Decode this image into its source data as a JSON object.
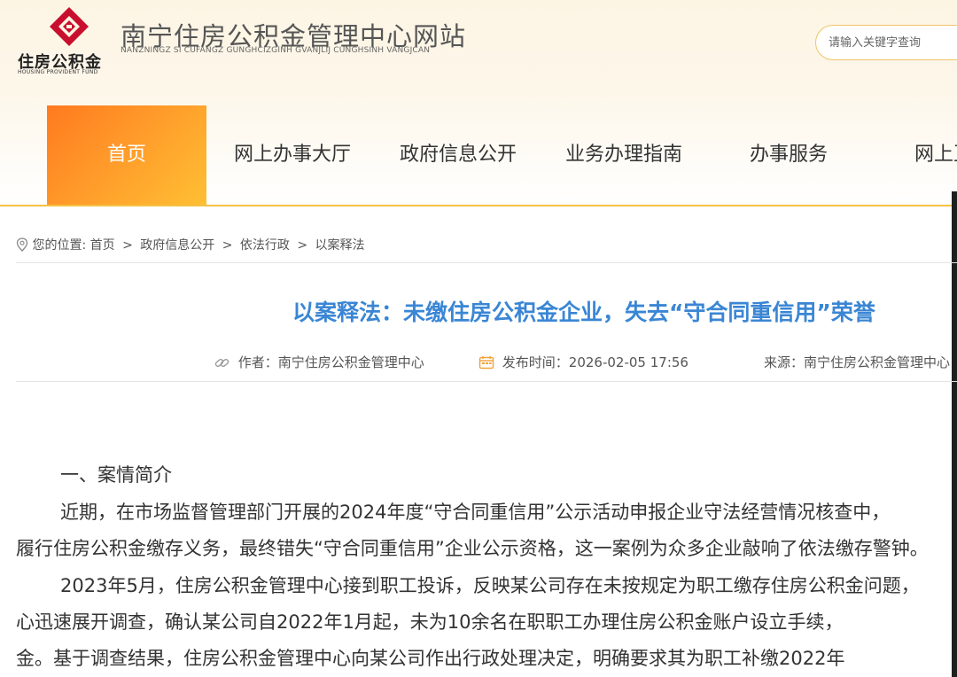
{
  "header": {
    "logo_text": "住房公积金",
    "logo_en": "HOUSING PROVIDENT FUND",
    "site_title": "南宁住房公积金管理中心网站",
    "site_subtitle": "NANZNINGZ SI CUFANGZ GUNGHCIZGINH GVANJLIJ CUNGHSINH VANGJCAN",
    "search_placeholder": "请输入关键字查询"
  },
  "nav": {
    "items": [
      {
        "label": "首页",
        "active": true
      },
      {
        "label": "网上办事大厅"
      },
      {
        "label": "政府信息公开"
      },
      {
        "label": "业务办理指南"
      },
      {
        "label": "办事服务"
      },
      {
        "label": "网上互动"
      }
    ]
  },
  "breadcrumb": {
    "prefix": "您的位置:",
    "items": [
      "首页",
      "政府信息公开",
      "依法行政",
      "以案释法"
    ],
    "separator": ">"
  },
  "article": {
    "title": "以案释法：未缴住房公积金企业，失去“守合同重信用”荣誉",
    "author_label": "作者：",
    "author": "南宁住房公积金管理中心",
    "date_label": "发布时间：",
    "date": "2026-02-05 17:56",
    "source_label": "来源：",
    "source": "南宁住房公积金管理中心",
    "paragraphs": [
      "一、案情简介",
      "近期，在市场监督管理部门开展的2024年度“守合同重信用”公示活动申报企业守法经营情况核查中，",
      "履行住房公积金缴存义务，最终错失“守合同重信用”企业公示资格，这一案例为众多企业敲响了依法缴存警钟。",
      "2023年5月，住房公积金管理中心接到职工投诉，反映某公司存在未按规定为职工缴存住房公积金问题，",
      "心迅速展开调查，确认某公司自2022年1月起，未为10余名在职职工办理住房公积金账户设立手续，",
      "金。基于调查结果，住房公积金管理中心向某公司作出行政处理决定，明确要求其为职工补缴2022年"
    ]
  },
  "colors": {
    "accent": "#f5c244",
    "title_blue": "#3a86d4",
    "logo_red": "#c8102e"
  }
}
